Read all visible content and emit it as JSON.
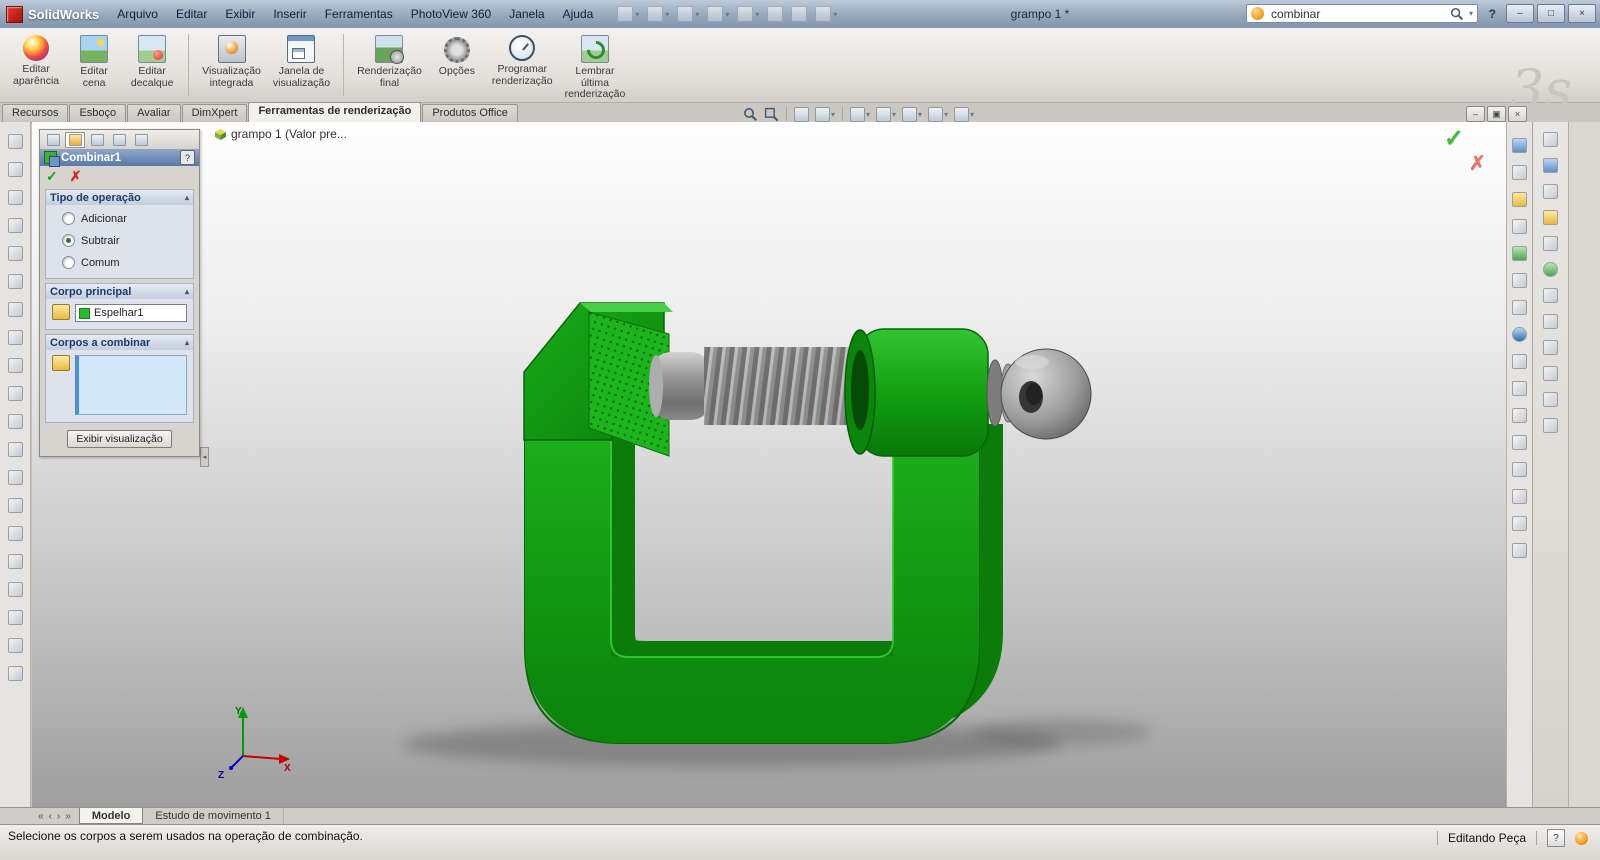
{
  "icons": {
    "check": "✓",
    "cross": "✗",
    "dropdown": "▾",
    "collapse": "▴",
    "nav_first": "«",
    "nav_prev": "‹",
    "nav_next": "›",
    "nav_last": "»",
    "minimize": "–",
    "maximize": "□",
    "restore": "▣",
    "close": "×",
    "splitter_left": "◂"
  },
  "titlebar": {
    "app_name": "SolidWorks",
    "menus": [
      "Arquivo",
      "Editar",
      "Exibir",
      "Inserir",
      "Ferramentas",
      "PhotoView 360",
      "Janela",
      "Ajuda"
    ],
    "document_title": "grampo 1 *",
    "search": {
      "value": "combinar"
    },
    "help": "?"
  },
  "ribbon": {
    "watermark": "3s",
    "buttons": [
      {
        "label": "Editar\naparência"
      },
      {
        "label": "Editar\ncena"
      },
      {
        "label": "Editar\ndecalque"
      },
      {
        "label": "Visualização\nintegrada"
      },
      {
        "label": "Janela de\nvisualização"
      },
      {
        "label": "Renderização\nfinal"
      },
      {
        "label": "Opções"
      },
      {
        "label": "Programar\nrenderização"
      },
      {
        "label": "Lembrar\núltima\nrenderização"
      }
    ]
  },
  "tabs": {
    "items": [
      "Recursos",
      "Esboço",
      "Avaliar",
      "DimXpert",
      "Ferramentas de renderização",
      "Produtos Office"
    ],
    "active": "Ferramentas de renderização"
  },
  "breadcrumb": {
    "text": "grampo 1  (Valor pre..."
  },
  "property_manager": {
    "title": "Combinar1",
    "help": "?",
    "operation": {
      "title": "Tipo de operação",
      "options": [
        "Adicionar",
        "Subtrair",
        "Comum"
      ],
      "selected": "Subtrair"
    },
    "main_body": {
      "title": "Corpo principal",
      "value": "Espelhar1"
    },
    "combine_bodies": {
      "title": "Corpos a combinar"
    },
    "preview_button": "Exibir visualização"
  },
  "viewport": {
    "triad": {
      "x": "X",
      "y": "Y",
      "z": "Z"
    },
    "model_colors": {
      "body_green": "#12a312",
      "screw_gray": "#8d8d8d"
    }
  },
  "bottom_tabs": {
    "items": [
      "Modelo",
      "Estudo de movimento 1"
    ],
    "active": "Modelo"
  },
  "statusbar": {
    "message": "Selecione os corpos a serem usados na operação de combinação.",
    "mode": "Editando Peça",
    "help": "?"
  }
}
